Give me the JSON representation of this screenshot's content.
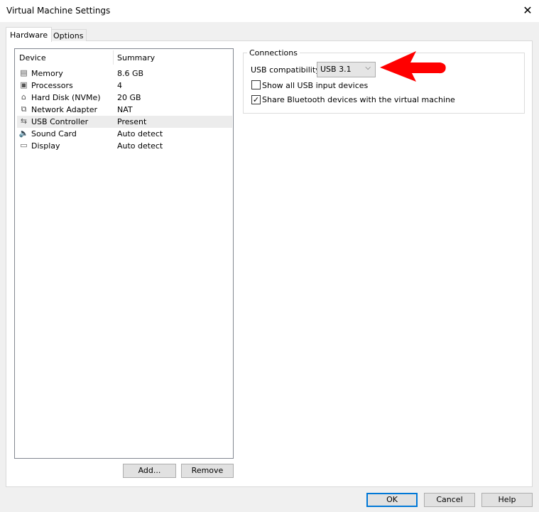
{
  "window": {
    "title": "Virtual Machine Settings",
    "close": "✕"
  },
  "tabs": [
    {
      "label": "Hardware",
      "active": true
    },
    {
      "label": "Options",
      "active": false
    }
  ],
  "device_list": {
    "headers": [
      "Device",
      "Summary"
    ],
    "rows": [
      {
        "icon": "memory-icon",
        "glyph": "▤",
        "device": "Memory",
        "summary": "8.6 GB"
      },
      {
        "icon": "processor-icon",
        "glyph": "▣",
        "device": "Processors",
        "summary": "4"
      },
      {
        "icon": "hard-disk-icon",
        "glyph": "⌂",
        "device": "Hard Disk (NVMe)",
        "summary": "20 GB"
      },
      {
        "icon": "network-adapter-icon",
        "glyph": "⧉",
        "device": "Network Adapter",
        "summary": "NAT"
      },
      {
        "icon": "usb-icon",
        "glyph": "⇆",
        "device": "USB Controller",
        "summary": "Present",
        "selected": true
      },
      {
        "icon": "sound-icon",
        "glyph": "🔈",
        "device": "Sound Card",
        "summary": "Auto detect"
      },
      {
        "icon": "display-icon",
        "glyph": "▭",
        "device": "Display",
        "summary": "Auto detect"
      }
    ]
  },
  "list_buttons": {
    "add": "Add...",
    "remove": "Remove"
  },
  "connections": {
    "group_label": "Connections",
    "usb_compat_label": "USB compatibility:",
    "usb_compat_value": "USB 3.1",
    "show_all_usb": {
      "label": "Show all USB input devices",
      "checked": false
    },
    "share_bluetooth": {
      "label": "Share Bluetooth devices with the virtual machine",
      "checked": true
    }
  },
  "annotation": {
    "arrow_color": "#ff0000"
  },
  "footer": {
    "ok": "OK",
    "cancel": "Cancel",
    "help": "Help"
  }
}
